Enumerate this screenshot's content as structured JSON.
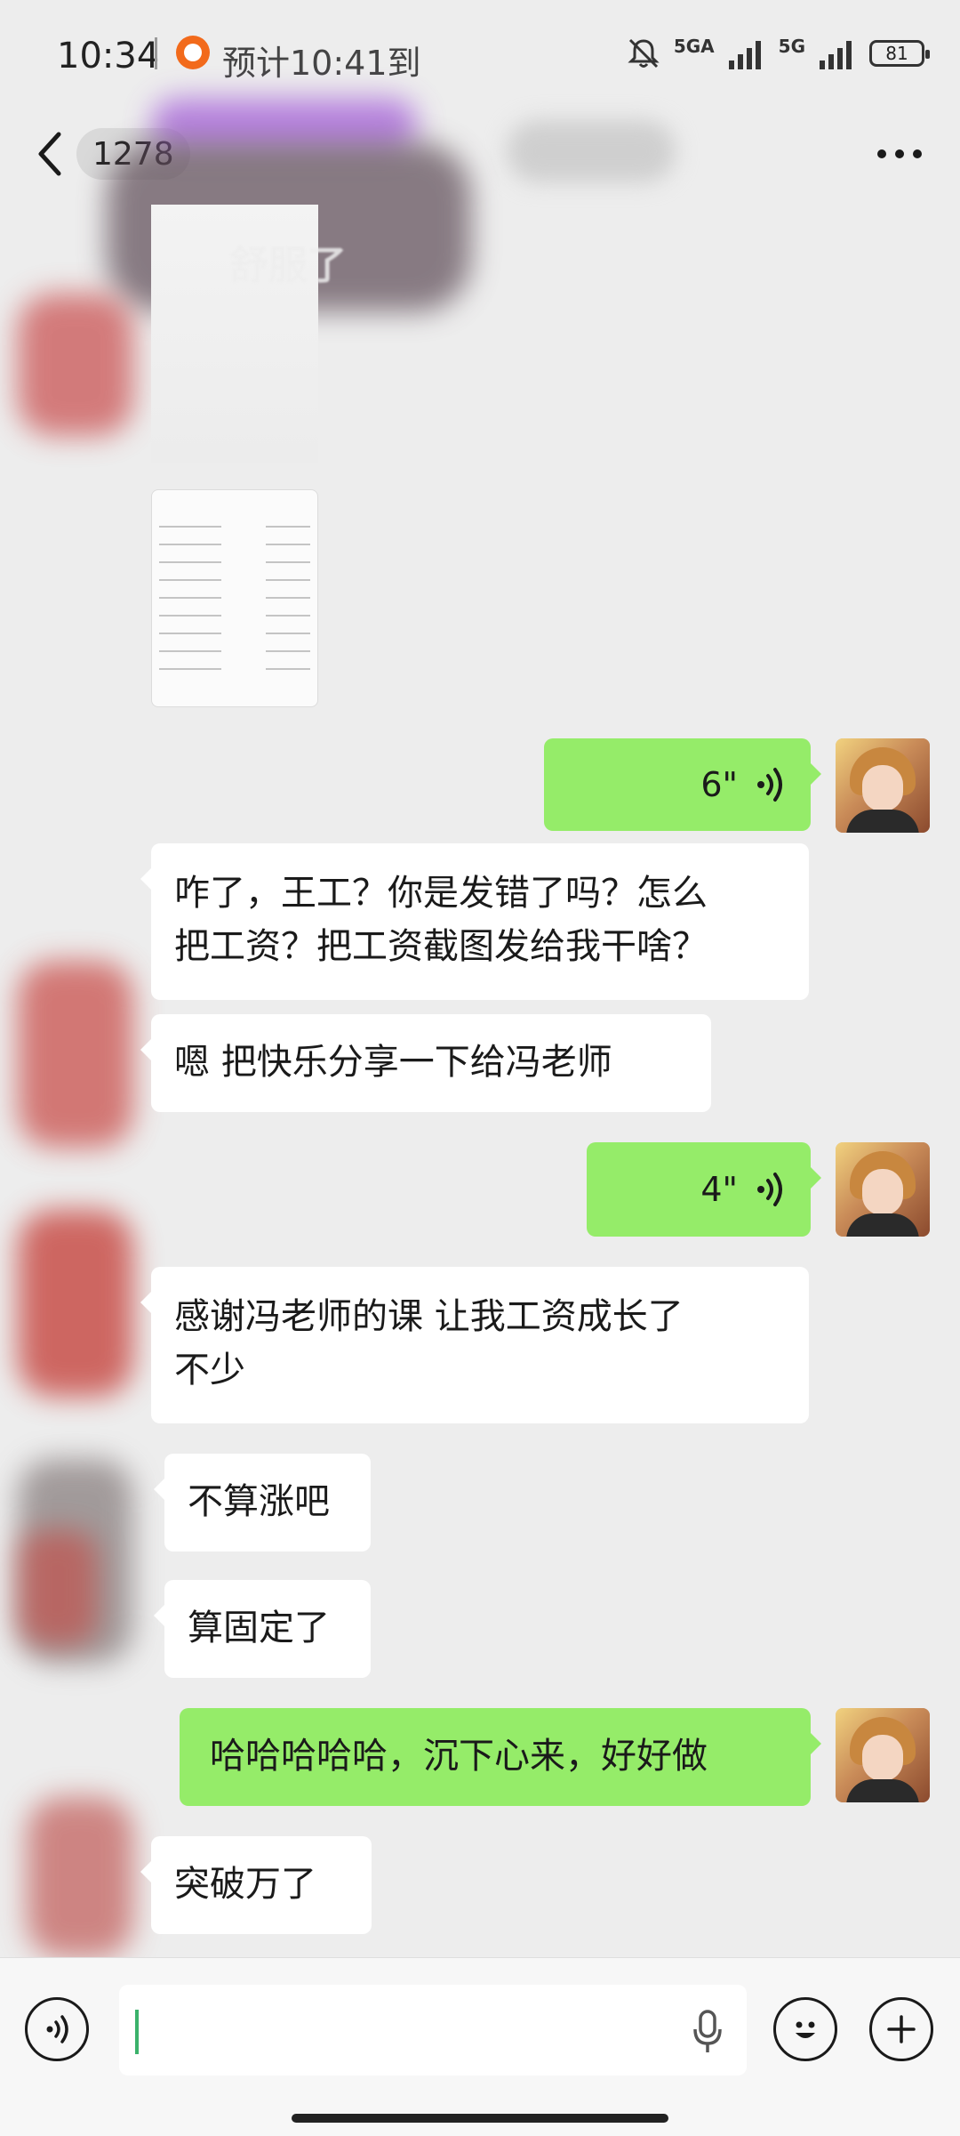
{
  "status_bar": {
    "time": "10:34",
    "eta": "预计10:41到",
    "network_1": "5GA",
    "network_2": "5G",
    "battery": "81",
    "icons": [
      "didi-app-icon",
      "bell-muted-icon",
      "signal-icon",
      "battery-icon"
    ]
  },
  "nav": {
    "unread_count": "1278",
    "icons": [
      "back-arrow-icon",
      "more-dots-icon"
    ]
  },
  "shared_image": {
    "caption": "舒服了"
  },
  "messages": [
    {
      "from": "other",
      "type": "image"
    },
    {
      "from": "me",
      "type": "voice",
      "duration": "6\""
    },
    {
      "from": "other",
      "type": "text",
      "lines": [
        "咋了，王工？你是发错了吗？怎么",
        "把工资？把工资截图发给我干啥？"
      ]
    },
    {
      "from": "other",
      "type": "text",
      "lines": [
        "嗯 把快乐分享一下给冯老师"
      ]
    },
    {
      "from": "me",
      "type": "voice",
      "duration": "4\""
    },
    {
      "from": "other",
      "type": "text",
      "lines": [
        "感谢冯老师的课 让我工资成长了",
        "不少"
      ]
    },
    {
      "from": "other",
      "type": "text",
      "lines": [
        "不算涨吧"
      ]
    },
    {
      "from": "other",
      "type": "text",
      "lines": [
        "算固定了"
      ]
    },
    {
      "from": "me",
      "type": "text",
      "lines": [
        "哈哈哈哈哈，沉下心来，好好做"
      ]
    },
    {
      "from": "other",
      "type": "text",
      "lines": [
        "突破万了"
      ]
    }
  ],
  "input_bar": {
    "value": "",
    "icons": [
      "voice-mode-icon",
      "microphone-icon",
      "emoji-icon",
      "plus-icon"
    ]
  },
  "colors": {
    "background": "#ededed",
    "outgoing_bubble": "#95ec69",
    "incoming_bubble": "#ffffff"
  }
}
